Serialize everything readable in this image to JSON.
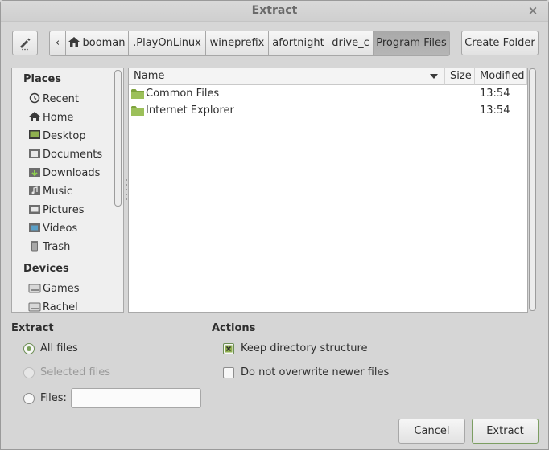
{
  "window": {
    "title": "Extract",
    "close_symbol": "×"
  },
  "toolbar": {
    "edit_icon": "pencil-icon",
    "back_symbol": "‹",
    "create_folder_label": "Create Folder"
  },
  "path": {
    "segments": [
      "booman",
      ".PlayOnLinux",
      "wineprefix",
      "afortnight",
      "drive_c",
      "Program Files"
    ],
    "active_index": 5
  },
  "sidebar": {
    "places_heading": "Places",
    "places": [
      {
        "label": "Recent",
        "icon": "recent-icon"
      },
      {
        "label": "Home",
        "icon": "home-icon"
      },
      {
        "label": "Desktop",
        "icon": "desktop-icon"
      },
      {
        "label": "Documents",
        "icon": "documents-icon"
      },
      {
        "label": "Downloads",
        "icon": "downloads-icon"
      },
      {
        "label": "Music",
        "icon": "music-icon"
      },
      {
        "label": "Pictures",
        "icon": "pictures-icon"
      },
      {
        "label": "Videos",
        "icon": "videos-icon"
      },
      {
        "label": "Trash",
        "icon": "trash-icon"
      }
    ],
    "devices_heading": "Devices",
    "devices": [
      {
        "label": "Games",
        "icon": "drive-icon"
      },
      {
        "label": "Rachel",
        "icon": "drive-icon"
      }
    ]
  },
  "filelist": {
    "columns": {
      "name": "Name",
      "size": "Size",
      "modified": "Modified"
    },
    "rows": [
      {
        "name": "Common Files",
        "size": "",
        "modified": "13:54"
      },
      {
        "name": "Internet Explorer",
        "size": "",
        "modified": "13:54"
      }
    ]
  },
  "extract": {
    "heading": "Extract",
    "all_files": "All files",
    "selected_files": "Selected files",
    "files_label": "Files:",
    "files_value": "",
    "selected": "all_files"
  },
  "actions": {
    "heading": "Actions",
    "keep_structure": "Keep directory structure",
    "keep_structure_checked": true,
    "no_overwrite": "Do not overwrite newer files",
    "no_overwrite_checked": false
  },
  "buttons": {
    "cancel": "Cancel",
    "extract": "Extract"
  },
  "colors": {
    "accent_green": "#7aa05a",
    "folder_green": "#8fb04f"
  }
}
